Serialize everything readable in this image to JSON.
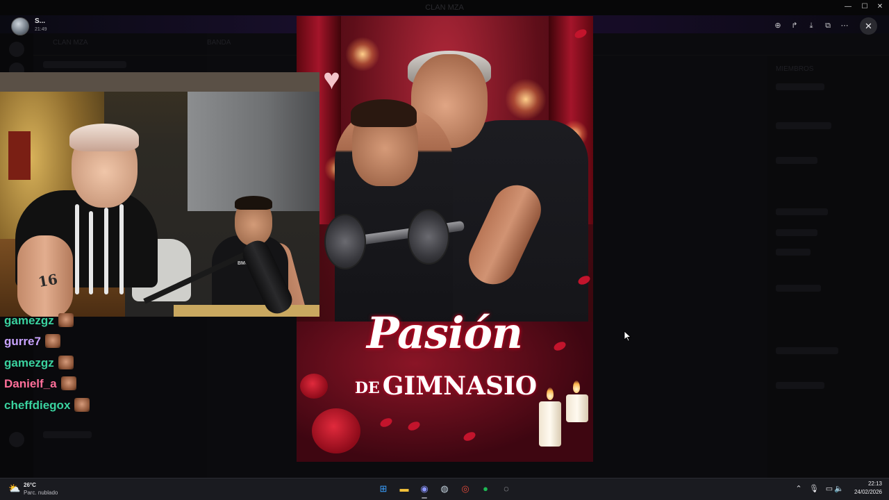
{
  "window": {
    "title": "CLAN MZA",
    "minimize_glyph": "—",
    "maximize_glyph": "☐",
    "close_glyph": "✕"
  },
  "viewer": {
    "user_name": "S...",
    "timestamp": "21:49",
    "tools": [
      {
        "icon": "zoom-in-icon",
        "glyph": "⊕"
      },
      {
        "icon": "forward-icon",
        "glyph": "↱"
      },
      {
        "icon": "download-icon",
        "glyph": "⤓"
      },
      {
        "icon": "open-external-icon",
        "glyph": "⧉"
      },
      {
        "icon": "more-icon",
        "glyph": "⋯"
      }
    ],
    "close_glyph": "✕"
  },
  "poster": {
    "title_line1": "Pasión",
    "title_de": "DE",
    "title_line2": "GIMNASIO",
    "tattoo_text": "16",
    "shirt_logo": "BMOKE"
  },
  "chat": [
    {
      "name": "gamezgz",
      "color": "#3ad29f"
    },
    {
      "name": "gurre7",
      "color": "#c9a3ff"
    },
    {
      "name": "gamezgz",
      "color": "#3ad29f"
    },
    {
      "name": "Danielf_a",
      "color": "#ff6f9a"
    },
    {
      "name": "cheffdiegox",
      "color": "#3ad29f"
    }
  ],
  "background": {
    "server_name": "CLAN MZA",
    "channel_hint": "BANDA",
    "member_header": "MIEMBROS"
  },
  "taskbar": {
    "weather_temp": "26°C",
    "weather_desc": "Parc. nublado",
    "weather_icon": "partly-cloudy-icon",
    "apps": [
      {
        "icon": "windows-start-icon",
        "glyph": "⊞",
        "color": "#3aa0ff"
      },
      {
        "icon": "file-explorer-icon",
        "glyph": "▬",
        "color": "#f3c13a"
      },
      {
        "icon": "discord-icon",
        "glyph": "◉",
        "color": "#5865f2"
      },
      {
        "icon": "steam-icon",
        "glyph": "◍",
        "color": "#1b2838"
      },
      {
        "icon": "chrome-icon",
        "glyph": "◎",
        "color": "#e24a3b"
      },
      {
        "icon": "spotify-icon",
        "glyph": "●",
        "color": "#1db954"
      },
      {
        "icon": "obs-icon",
        "glyph": "◌",
        "color": "#2f2f35"
      }
    ],
    "tray": [
      {
        "icon": "chevron-up-icon",
        "glyph": "⌃"
      },
      {
        "icon": "microphone-icon",
        "glyph": "🎙"
      },
      {
        "icon": "network-icon",
        "glyph": "▭"
      },
      {
        "icon": "volume-icon",
        "glyph": "🔈"
      }
    ],
    "time": "22:13",
    "date": "24/02/2026"
  }
}
